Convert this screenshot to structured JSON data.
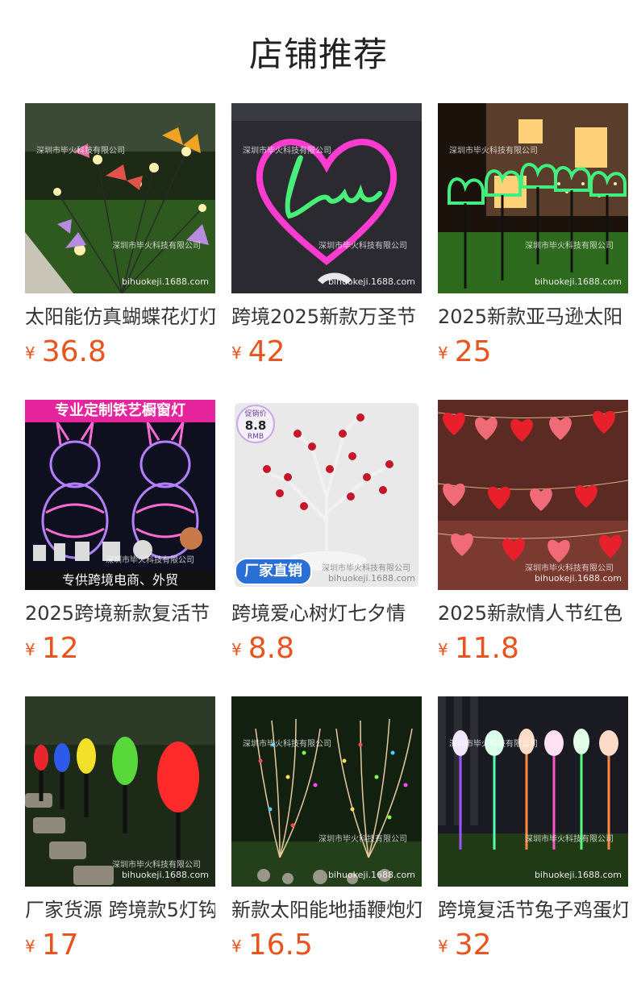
{
  "page": {
    "title": "店铺推荐"
  },
  "watermarks": {
    "company": "深圳市毕火科技有限公司",
    "site": "bihuokeji.1688.com"
  },
  "products": [
    {
      "name": "太阳能仿真蝴蝶花灯灯",
      "currency": "¥",
      "price": "36.8"
    },
    {
      "name": "跨境2025新款万圣节",
      "currency": "¥",
      "price": "42"
    },
    {
      "name": "2025新款亚马逊太阳",
      "currency": "¥",
      "price": "25"
    },
    {
      "name": "2025跨境新款复活节",
      "currency": "¥",
      "price": "12",
      "top_banner": "专业定制铁艺橱窗灯",
      "bottom_banner": "专供跨境电商、外贸"
    },
    {
      "name": "跨境爱心树灯七夕情",
      "currency": "¥",
      "price": "8.8",
      "promo_label": "促销价",
      "promo_value": "8.8",
      "promo_unit": "RMB",
      "badge": "厂家直销"
    },
    {
      "name": "2025新款情人节红色",
      "currency": "¥",
      "price": "11.8"
    },
    {
      "name": "厂家货源 跨境款5灯钩",
      "currency": "¥",
      "price": "17"
    },
    {
      "name": "新款太阳能地插鞭炮灯",
      "currency": "¥",
      "price": "16.5"
    },
    {
      "name": "跨境复活节兔子鸡蛋灯",
      "currency": "¥",
      "price": "32"
    }
  ]
}
